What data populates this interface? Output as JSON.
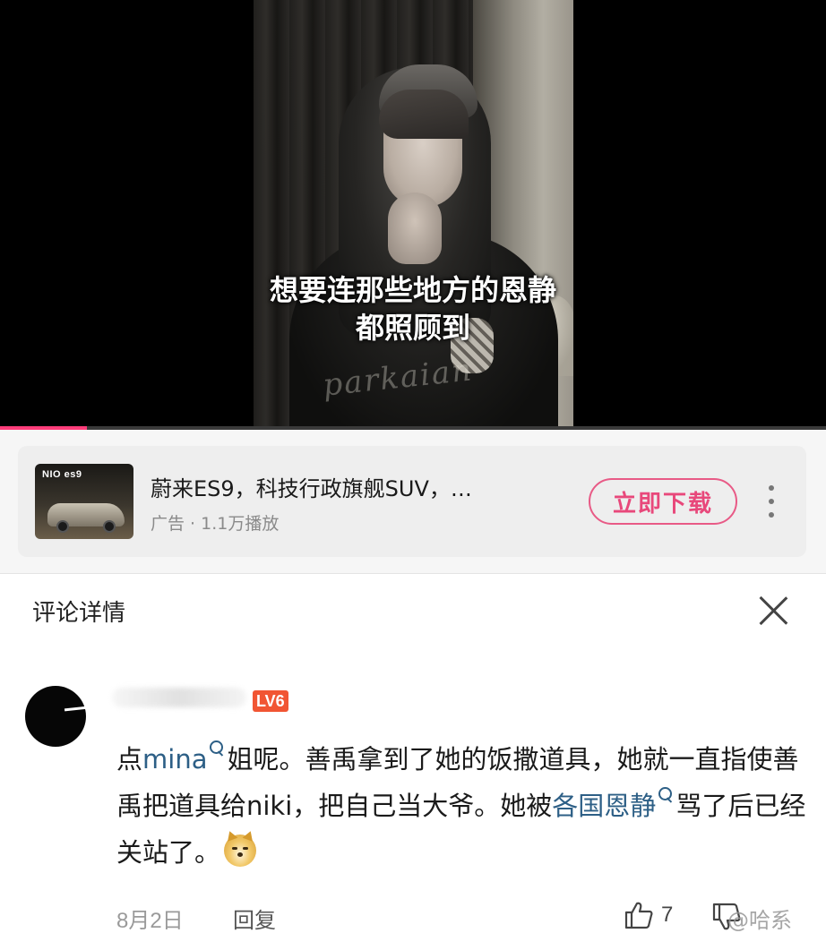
{
  "video": {
    "subtitle_line1": "想要连那些地方的恩静",
    "subtitle_line2": "都照顾到",
    "signature": "parkaian",
    "progress_percent": 10.5,
    "progress_color": "#ff3d7a"
  },
  "ad": {
    "thumbnail_brand": "NIO es9",
    "title": "蔚来ES9，科技行政旗舰SUV，…",
    "meta": "广告 · 1.1万播放",
    "cta_label": "立即下载",
    "cta_color": "#e8487b",
    "more_icon": "more-vertical-icon"
  },
  "panel": {
    "title": "评论详情",
    "close_icon": "close-icon"
  },
  "comment": {
    "badge": "LV6",
    "badge_color": "#f15533",
    "seg1": "点",
    "link1": "mina",
    "seg2": "姐呢。善禹拿到了她的饭撒道具，她就一直指使善禹把道具给niki，把自己当大爷。她被",
    "link2": "各国恩静",
    "seg3": "骂了后已经关站了。",
    "link_color": "#2d5f86",
    "emoji": "doge-icon",
    "date": "8月2日",
    "reply_label": "回复",
    "like_count": "7"
  },
  "watermark": "@哈系"
}
